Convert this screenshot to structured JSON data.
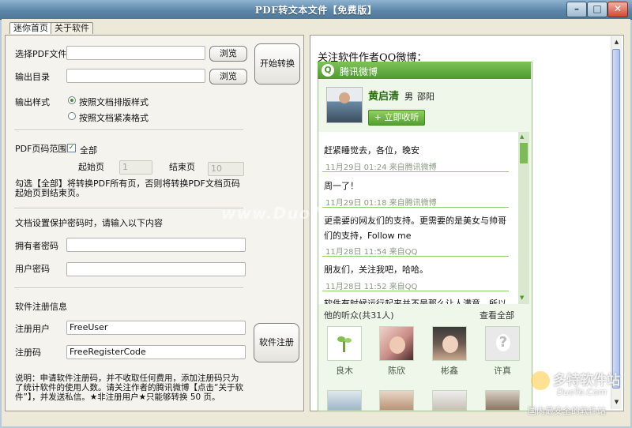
{
  "window": {
    "title": "PDF转文本文件【免费版】",
    "min": "–",
    "max": "□",
    "close": "✕"
  },
  "tabs": [
    {
      "label": "迷你首页"
    },
    {
      "label": "关于软件"
    }
  ],
  "form": {
    "select_pdf_label": "选择PDF文件",
    "select_pdf_value": "",
    "browse_label": "浏览",
    "output_dir_label": "输出目录",
    "output_dir_value": "",
    "start_button": "开始转换",
    "output_style_label": "输出样式",
    "style_option_1": "按照文档排版样式",
    "style_option_2": "按照文档紧凑格式",
    "page_range_label": "PDF页码范围",
    "all_pages_label": "全部",
    "start_page_label": "起始页",
    "start_page_value": "1",
    "end_page_label": "结束页",
    "end_page_value": "10",
    "range_note": "勾选【全部】将转换PDF所有页，否则将转换PDF文档页码起始页到结束页。",
    "password_hint": "文档设置保护密码时，请输入以下内容",
    "owner_pw_label": "拥有者密码",
    "user_pw_label": "用户密码",
    "reg_info_label": "软件注册信息",
    "reg_user_label": "注册用户",
    "reg_user_value": "FreeUser",
    "reg_code_label": "注册码",
    "reg_code_value": "FreeRegisterCode",
    "register_button": "软件注册",
    "footnote": "说明：申请软件注册码，并不收取任何费用，添加注册码只为了统计软件的使用人数。请关注作者的腾讯微博【点击“关于软件”】，并发送私信。★非注册用户★只能够转换 50 页。"
  },
  "right": {
    "heading": "关注软件作者QQ微博：",
    "widget_title": "腾讯微博",
    "user_name": "黄启清",
    "user_gender": "男",
    "user_city": "邵阳",
    "follow_button": "立即收听",
    "feed": [
      {
        "text": "赶紧睡觉去，各位，晚安",
        "meta": "11月29日  01:24 来自腾讯微博"
      },
      {
        "text": "周一了！",
        "meta": "11月29日  01:18 来自腾讯微博"
      },
      {
        "text": "更需要的网友们的支持。更需要的是美女与帅哥们的支持，Follow me",
        "meta": "11月28日  11:54 来自QQ"
      },
      {
        "text": "朋友们，关注我吧，哈哈。",
        "meta": "11月28日  11:52 来自QQ"
      },
      {
        "text": "软件有时候运行起来并不是那么让人满意，所以",
        "meta": ""
      }
    ],
    "fans_label": "他的听众(共31人)",
    "view_all": "查看全部",
    "fans": [
      {
        "name": "良木"
      },
      {
        "name": "陈欣"
      },
      {
        "name": "彬鑫"
      },
      {
        "name": "许真"
      }
    ]
  },
  "watermarks": {
    "center": "www.DuoTe.com",
    "brand": "多特软件站",
    "brand_url": "DuoTe.Com",
    "brand_slogan": "国内最安全的软件站"
  }
}
